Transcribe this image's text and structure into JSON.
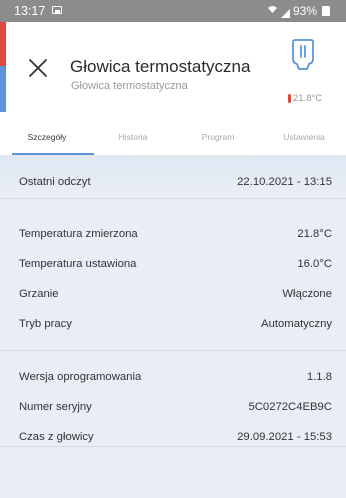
{
  "status_bar": {
    "time": "13:17",
    "battery_text": "93%"
  },
  "header": {
    "title": "Głowica termostatyczna",
    "subtitle": "Głowica termostatyczna",
    "temperature": "21.8°C",
    "device_icon": "thermostat-head-icon",
    "accent_colors": [
      "#e0473d",
      "#5c93d8"
    ]
  },
  "tabs": [
    {
      "label": "Szczegóły",
      "active": true
    },
    {
      "label": "Historia",
      "active": false
    },
    {
      "label": "Program",
      "active": false
    },
    {
      "label": "Ustawienia",
      "active": false
    }
  ],
  "details": {
    "last_reading": {
      "label": "Ostatni odczyt",
      "value": "22.10.2021 - 13:15"
    },
    "measured_temp": {
      "label": "Temperatura zmierzona",
      "value": "21.8°C"
    },
    "set_temp": {
      "label": "Temperatura ustawiona",
      "value": "16.0°C"
    },
    "heating": {
      "label": "Grzanie",
      "value": "Włączone"
    },
    "mode": {
      "label": "Tryb pracy",
      "value": "Automatyczny"
    },
    "firmware": {
      "label": "Wersja oprogramowania",
      "value": "1.1.8"
    },
    "serial": {
      "label": "Numer seryjny",
      "value": "5C0272C4EB9C"
    },
    "head_time": {
      "label": "Czas z głowicy",
      "value": "29.09.2021 - 15:53"
    }
  }
}
